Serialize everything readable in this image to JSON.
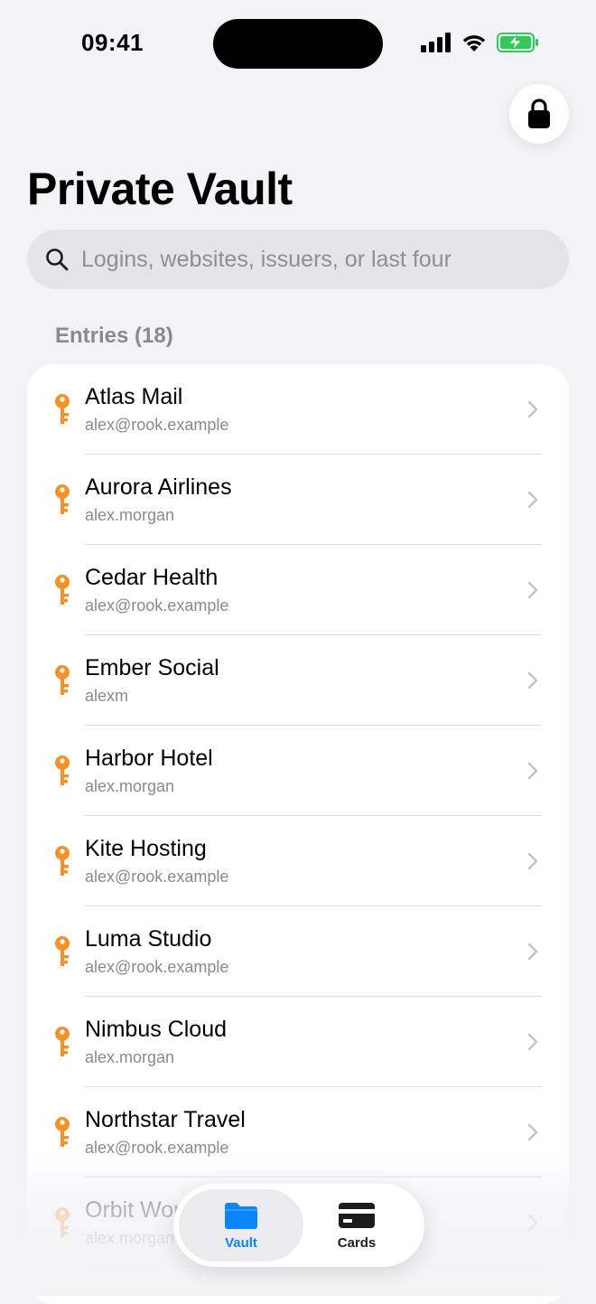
{
  "status_bar": {
    "time": "09:41"
  },
  "header": {
    "title": "Private Vault"
  },
  "search": {
    "placeholder": "Logins, websites, issuers, or last four"
  },
  "section": {
    "title": "Entries (18)"
  },
  "entries": [
    {
      "title": "Atlas Mail",
      "subtitle": "alex@rook.example"
    },
    {
      "title": "Aurora Airlines",
      "subtitle": "alex.morgan"
    },
    {
      "title": "Cedar Health",
      "subtitle": "alex@rook.example"
    },
    {
      "title": "Ember Social",
      "subtitle": "alexm"
    },
    {
      "title": "Harbor Hotel",
      "subtitle": "alex.morgan"
    },
    {
      "title": "Kite Hosting",
      "subtitle": "alex@rook.example"
    },
    {
      "title": "Luma Studio",
      "subtitle": "alex@rook.example"
    },
    {
      "title": "Nimbus Cloud",
      "subtitle": "alex.morgan"
    },
    {
      "title": "Northstar Travel",
      "subtitle": "alex@rook.example"
    },
    {
      "title": "Orbit Works",
      "subtitle": "alex.morgan"
    }
  ],
  "tabs": [
    {
      "label": "Vault",
      "icon": "folder-icon",
      "active": true
    },
    {
      "label": "Cards",
      "icon": "credit-card-icon",
      "active": false
    }
  ],
  "colors": {
    "accent": "#0a84ff",
    "key_icon": "#f5922a",
    "battery": "#34c759"
  }
}
